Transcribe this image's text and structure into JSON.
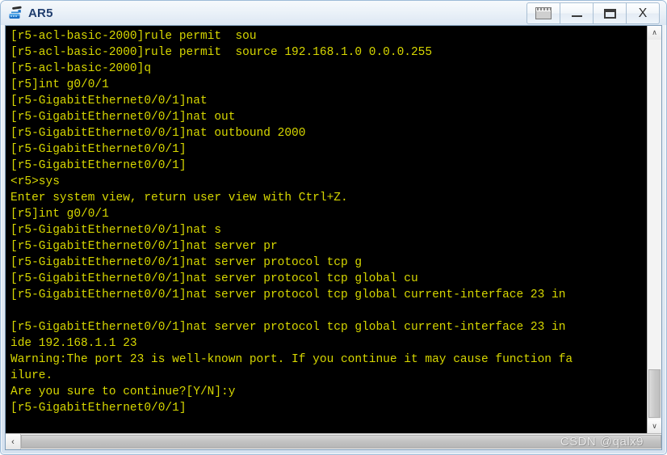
{
  "window": {
    "title": "AR5",
    "icon": "router-icon",
    "colors": {
      "terminal_bg": "#000000",
      "terminal_fg": "#d7d700",
      "title_fg": "#1f3d6e",
      "frame": "#9dbbd8"
    },
    "controls": [
      {
        "name": "restore-button",
        "glyph": "restore"
      },
      {
        "name": "minimize-button",
        "glyph": "minimize"
      },
      {
        "name": "maximize-button",
        "glyph": "maximize"
      },
      {
        "name": "close-button",
        "glyph": "X"
      }
    ]
  },
  "terminal": {
    "lines": [
      "[r5-acl-basic-2000]rule permit  sou",
      "[r5-acl-basic-2000]rule permit  source 192.168.1.0 0.0.0.255",
      "[r5-acl-basic-2000]q",
      "[r5]int g0/0/1",
      "[r5-GigabitEthernet0/0/1]nat",
      "[r5-GigabitEthernet0/0/1]nat out",
      "[r5-GigabitEthernet0/0/1]nat outbound 2000",
      "[r5-GigabitEthernet0/0/1]",
      "[r5-GigabitEthernet0/0/1]",
      "<r5>sys",
      "Enter system view, return user view with Ctrl+Z.",
      "[r5]int g0/0/1",
      "[r5-GigabitEthernet0/0/1]nat s",
      "[r5-GigabitEthernet0/0/1]nat server pr",
      "[r5-GigabitEthernet0/0/1]nat server protocol tcp g",
      "[r5-GigabitEthernet0/0/1]nat server protocol tcp global cu",
      "[r5-GigabitEthernet0/0/1]nat server protocol tcp global current-interface 23 in",
      "",
      "[r5-GigabitEthernet0/0/1]nat server protocol tcp global current-interface 23 in",
      "ide 192.168.1.1 23",
      "Warning:The port 23 is well-known port. If you continue it may cause function fa",
      "ilure.",
      "Are you sure to continue?[Y/N]:y",
      "[r5-GigabitEthernet0/0/1]"
    ]
  },
  "scrollbars": {
    "vertical": {
      "up_arrow": "∧",
      "down_arrow": "∨"
    },
    "horizontal": {
      "left_arrow": "‹"
    }
  },
  "watermark": {
    "text": "CSDN @qalx9"
  }
}
